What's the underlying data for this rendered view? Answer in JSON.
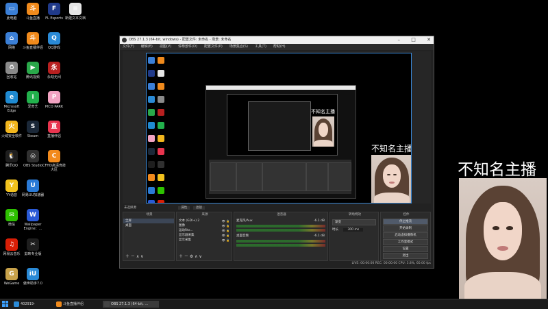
{
  "desktop": {
    "icons": [
      {
        "label": "此电脑",
        "color": "#3b7fd6",
        "glyph": "▭"
      },
      {
        "label": "斗鱼直播",
        "color": "#f08a1c",
        "glyph": "斗"
      },
      {
        "label": "FL Esports",
        "color": "#203a8a",
        "glyph": "F"
      },
      {
        "label": "新建文本文档",
        "color": "#e6e6e6",
        "glyph": "≡"
      },
      {
        "label": "网络",
        "color": "#3b7fd6",
        "glyph": "⌂"
      },
      {
        "label": "斗鱼直播伴侣",
        "color": "#f08a1c",
        "glyph": "斗"
      },
      {
        "label": "QQ游戏",
        "color": "#2a8ad6",
        "glyph": "Q"
      },
      {
        "label": "回收站",
        "color": "#8a8a8a",
        "glyph": "♻"
      },
      {
        "label": "腾讯视频",
        "color": "#2aa84a",
        "glyph": "▶"
      },
      {
        "label": "永劫无间",
        "color": "#b82020",
        "glyph": "永"
      },
      {
        "label": "Microsoft Edge",
        "color": "#1f8ad1",
        "glyph": "e"
      },
      {
        "label": "爱奇艺",
        "color": "#22b14c",
        "glyph": "i"
      },
      {
        "label": "PICO PARK",
        "color": "#f2a3c2",
        "glyph": "P"
      },
      {
        "label": "火绒安全软件",
        "color": "#f2b61d",
        "glyph": "火"
      },
      {
        "label": "Steam",
        "color": "#1b2838",
        "glyph": "S"
      },
      {
        "label": "直播伴侣",
        "color": "#e8344e",
        "glyph": "直"
      },
      {
        "label": "腾讯QQ",
        "color": "#1e1e1e",
        "glyph": "🐧"
      },
      {
        "label": "OBS Studio",
        "color": "#303030",
        "glyph": "◎"
      },
      {
        "label": "CFHD高清竞技大区",
        "color": "#f28a1c",
        "glyph": "C"
      },
      {
        "label": "YY语音",
        "color": "#f2c21d",
        "glyph": "Y"
      },
      {
        "label": "网易UU加速器",
        "color": "#2a7ad6",
        "glyph": "U"
      },
      {
        "label": "微信",
        "color": "#2dc100",
        "glyph": "✉"
      },
      {
        "label": "Wallpaper Engine：...",
        "color": "#2a5ad6",
        "glyph": "W"
      },
      {
        "label": "网易云音乐",
        "color": "#d81e06",
        "glyph": "♫"
      },
      {
        "label": "剪映专业版",
        "color": "#1e1e1e",
        "glyph": "✂"
      },
      {
        "label": "WeGame",
        "color": "#c8a24a",
        "glyph": "G"
      },
      {
        "label": "傲世助手7.0",
        "color": "#2a8ad6",
        "glyph": "iU"
      }
    ]
  },
  "taskbar": {
    "items": [
      {
        "label": "402919-",
        "color": "#2a8ad6"
      },
      {
        "label": "斗鱼直播伴侣",
        "color": "#f08a1c"
      },
      {
        "label": "OBS 27.1.3 (64-bit, ...",
        "color": "#444444"
      }
    ]
  },
  "obs": {
    "title": "OBS 27.1.3 (64-bit, windows) - 配置文件: 未命名 - 场景: 未命名",
    "menu": [
      "文件(F)",
      "编辑(E)",
      "视图(V)",
      "停靠部件(D)",
      "配置文件(P)",
      "场景集合(S)",
      "工具(T)",
      "帮助(H)"
    ],
    "scene_bar": "未选择源",
    "scene_buttons": [
      "属性",
      "滤镜"
    ],
    "docks": {
      "scenes": {
        "title": "场景",
        "items": [
          "全屏",
          "桌面"
        ]
      },
      "sources": {
        "title": "来源",
        "items": [
          "文本 (GDI+) 2",
          "图像",
          "运动Rtx...",
          "显示器采集",
          "显示采集"
        ]
      },
      "mixer": {
        "title": "混音器",
        "channels": [
          {
            "name": "麦克风/Aux",
            "level": "-6.1 dB"
          },
          {
            "name": "桌面音频",
            "level": "-6.1 dB"
          }
        ]
      },
      "transitions": {
        "title": "转场特效",
        "type": "渐变",
        "duration_label": "时长",
        "duration": "300 ms"
      },
      "controls": {
        "title": "控件",
        "buttons": [
          "停止推流",
          "开始录制",
          "启动虚拟摄像机",
          "工作室模式",
          "设置",
          "退出"
        ]
      }
    },
    "status": "LIVE: 00:00:00   REC: 00:00:00   CPU: 3.8%, 60.00 fps"
  },
  "overlay": {
    "streamer_label": "不知名主播"
  }
}
